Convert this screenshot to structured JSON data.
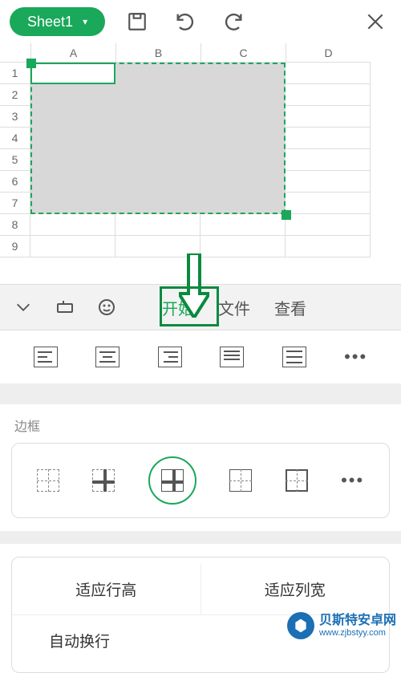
{
  "topbar": {
    "sheet_name": "Sheet1"
  },
  "sheet": {
    "columns": [
      "A",
      "B",
      "C",
      "D"
    ],
    "rows": [
      "1",
      "2",
      "3",
      "4",
      "5",
      "6",
      "7",
      "8",
      "9"
    ],
    "selection": "A1:C7",
    "active_cell": "A1"
  },
  "tabs": {
    "start": "开始",
    "file": "文件",
    "view": "查看"
  },
  "border": {
    "title": "边框"
  },
  "fit": {
    "row_height": "适应行高",
    "col_width": "适应列宽",
    "wrap": "自动换行"
  },
  "watermark": {
    "name": "贝斯特安卓网",
    "url": "www.zjbstyy.com"
  },
  "colors": {
    "accent": "#1aa85a"
  }
}
